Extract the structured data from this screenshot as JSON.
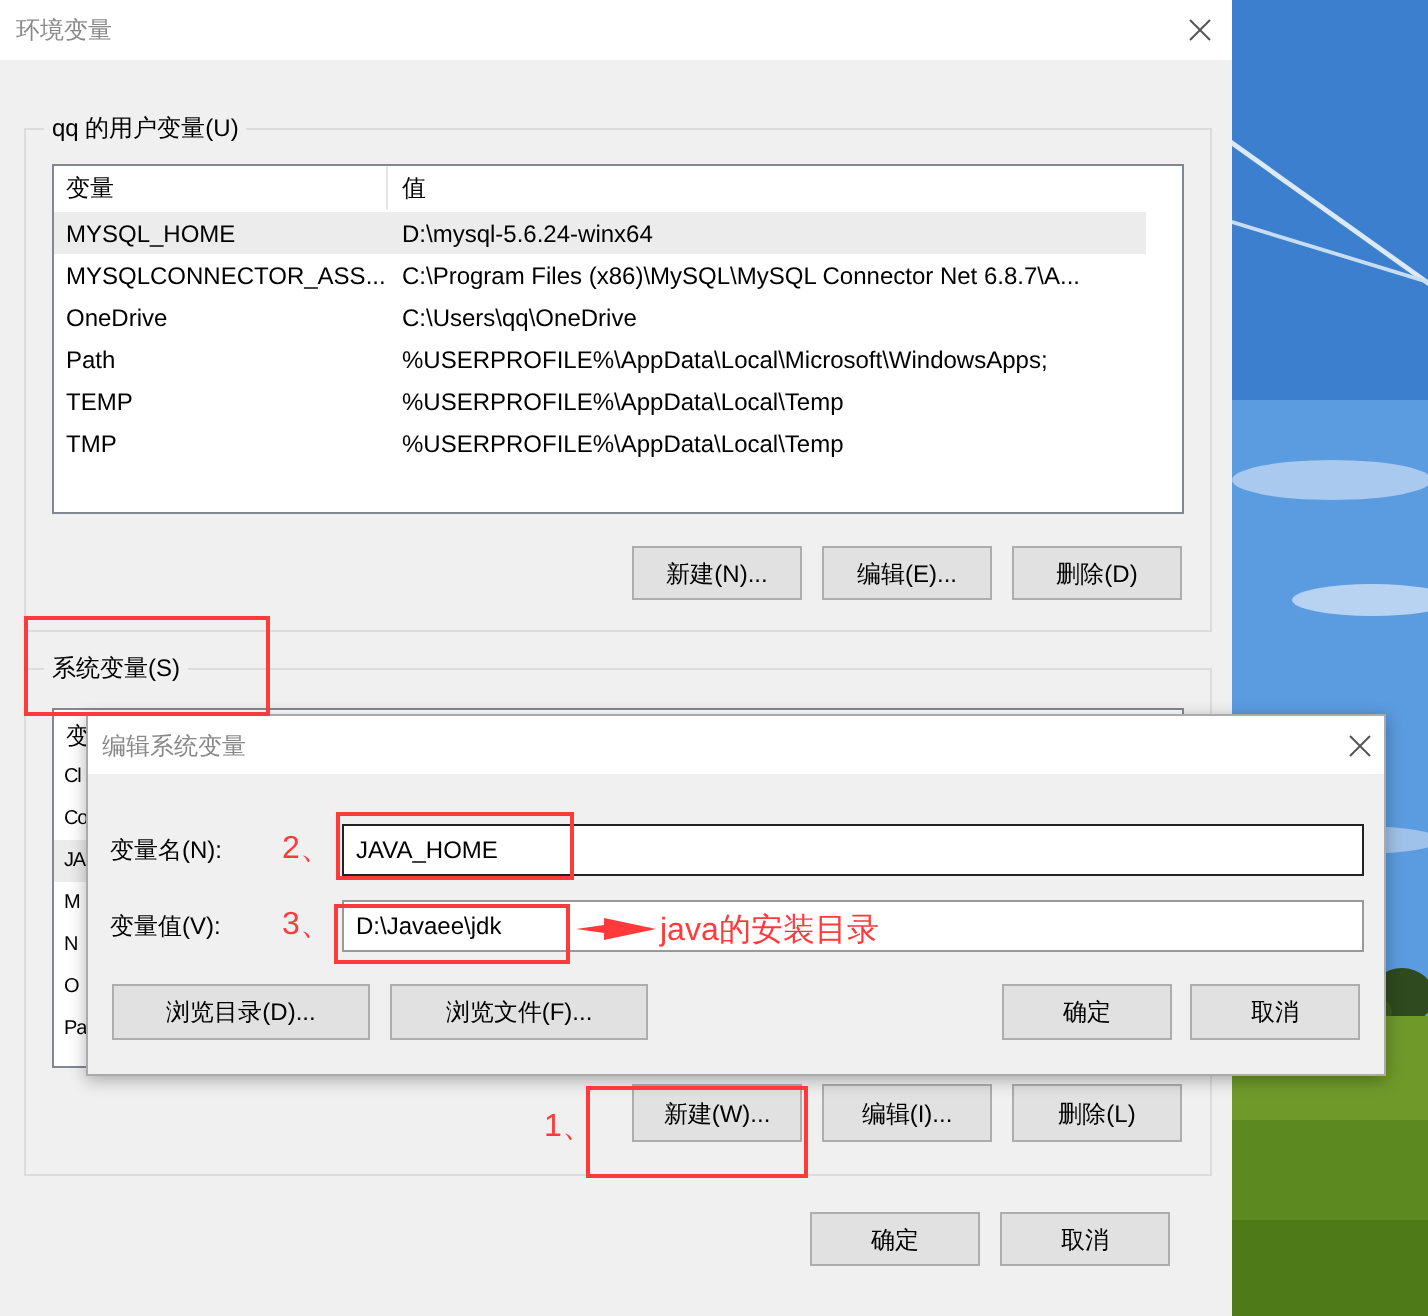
{
  "main_window": {
    "title": "环境变量"
  },
  "user_variables": {
    "label": "qq 的用户变量(U)",
    "columns": [
      "变量",
      "值"
    ],
    "rows": [
      {
        "name": "MYSQL_HOME",
        "value": "D:\\mysql-5.6.24-winx64",
        "selected": true
      },
      {
        "name": "MYSQLCONNECTOR_ASS...",
        "value": "C:\\Program Files (x86)\\MySQL\\MySQL Connector Net 6.8.7\\A...",
        "selected": false
      },
      {
        "name": "OneDrive",
        "value": "C:\\Users\\qq\\OneDrive",
        "selected": false
      },
      {
        "name": "Path",
        "value": "%USERPROFILE%\\AppData\\Local\\Microsoft\\WindowsApps;",
        "selected": false
      },
      {
        "name": "TEMP",
        "value": "%USERPROFILE%\\AppData\\Local\\Temp",
        "selected": false
      },
      {
        "name": "TMP",
        "value": "%USERPROFILE%\\AppData\\Local\\Temp",
        "selected": false
      }
    ],
    "buttons": [
      "新建(N)...",
      "编辑(E)...",
      "删除(D)"
    ]
  },
  "system_variables": {
    "label": "系统变量(S)",
    "columns": [
      "变"
    ],
    "rows": [
      {
        "name": "Cl",
        "selected": false
      },
      {
        "name": "Co",
        "selected": false
      },
      {
        "name": "JA",
        "selected": true
      },
      {
        "name": "M",
        "selected": false
      },
      {
        "name": "N",
        "selected": false
      },
      {
        "name": "O",
        "selected": false
      },
      {
        "name": "Pa",
        "selected": false
      }
    ],
    "buttons": [
      "新建(W)...",
      "编辑(I)...",
      "删除(L)"
    ]
  },
  "dialog_buttons": [
    "确定",
    "取消"
  ],
  "edit_dialog": {
    "title": "编辑系统变量",
    "fields": [
      {
        "label": "变量名(N):",
        "marker": "2、",
        "value": "JAVA_HOME",
        "focused": true
      },
      {
        "label": "变量值(V):",
        "marker": "3、",
        "value": "D:\\Javaee\\jdk",
        "focused": false
      }
    ],
    "browse_buttons": [
      "浏览目录(D)...",
      "浏览文件(F)..."
    ],
    "buttons": [
      "确定",
      "取消"
    ]
  },
  "annotations": {
    "step_marker": "1、",
    "note": "java的安装目录"
  }
}
